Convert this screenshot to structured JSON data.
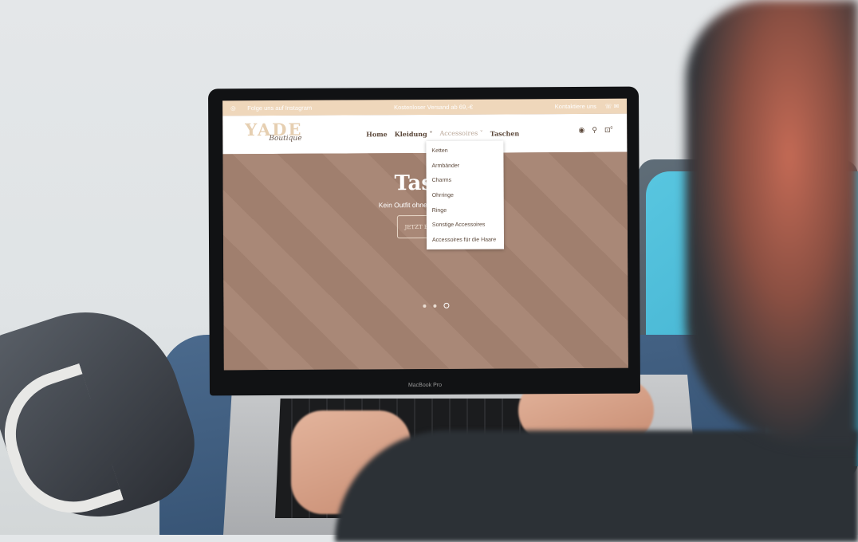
{
  "device": {
    "label": "MacBook Pro"
  },
  "topbar": {
    "instagram": "Folge uns auf Instagram",
    "shipping": "Kostenloser Versand ab 69,-€",
    "contact": "Kontaktiere uns"
  },
  "logo": {
    "main": "YADE",
    "script": "Boutique"
  },
  "nav": {
    "items": [
      "Home",
      "Kleidung ˅",
      "Accessoires ˅",
      "Taschen"
    ],
    "cart_count": "0"
  },
  "dropdown": [
    "Ketten",
    "Armbänder",
    "Charms",
    "Ohrringe",
    "Ringe",
    "Sonstige Accessoires",
    "Accessoires für die Haare"
  ],
  "hero": {
    "title": "Taschen",
    "subtitle": "Kein Outfit ohne passender Tasche!",
    "cta": "JETZT ENTDECKEN",
    "slide_index": 3,
    "slide_count": 3
  }
}
